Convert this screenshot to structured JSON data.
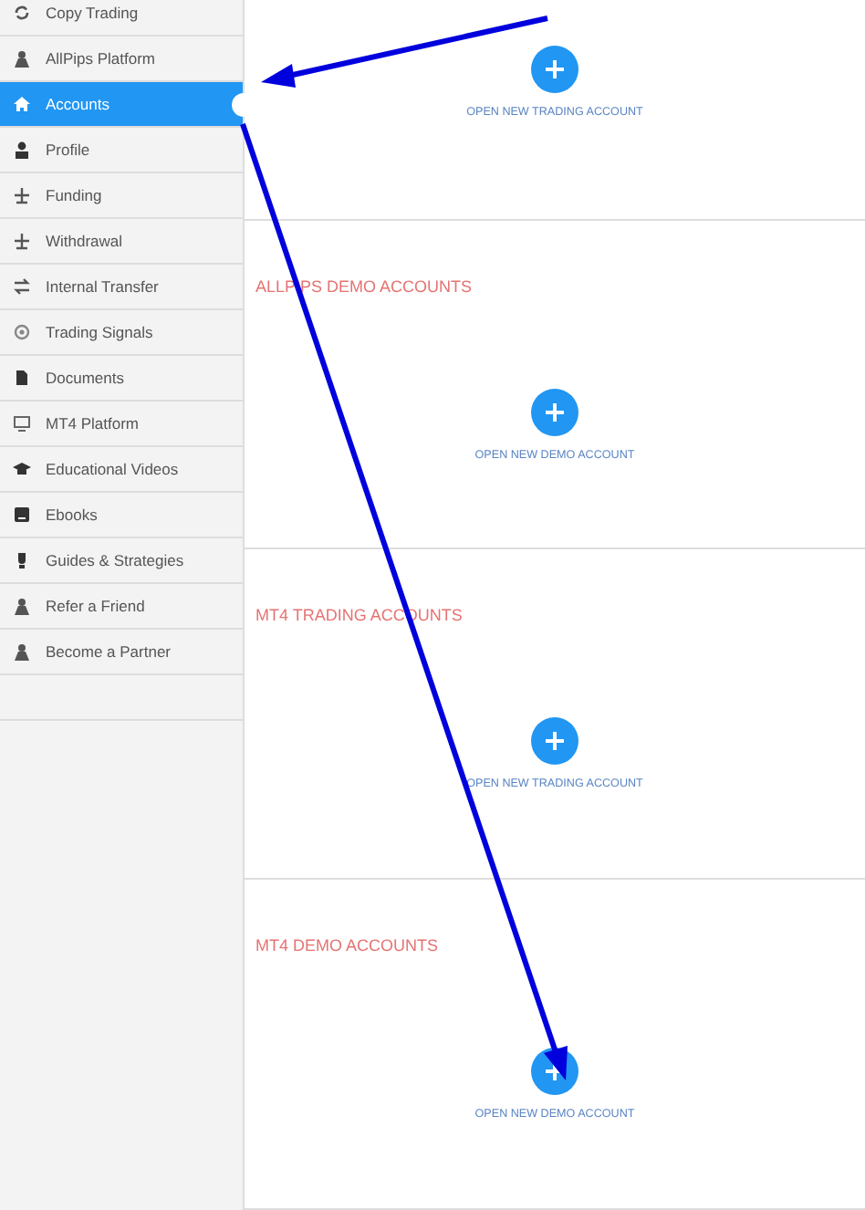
{
  "sidebar": {
    "items": [
      {
        "label": "Copy Trading",
        "selected": false
      },
      {
        "label": "AllPips Platform",
        "selected": false
      },
      {
        "label": "Accounts",
        "selected": true
      },
      {
        "label": "Profile",
        "selected": false
      },
      {
        "label": "Funding",
        "selected": false
      },
      {
        "label": "Withdrawal",
        "selected": false
      },
      {
        "label": "Internal Transfer",
        "selected": false
      },
      {
        "label": "Trading Signals",
        "selected": false
      },
      {
        "label": "Documents",
        "selected": false
      },
      {
        "label": "MT4 Platform",
        "selected": false
      },
      {
        "label": "Educational Videos",
        "selected": false
      },
      {
        "label": "Ebooks",
        "selected": false
      },
      {
        "label": "Guides & Strategies",
        "selected": false
      },
      {
        "label": "Refer a Friend",
        "selected": false
      },
      {
        "label": "Become a Partner",
        "selected": false
      }
    ]
  },
  "sections": [
    {
      "button_label": "OPEN NEW TRADING ACCOUNT"
    },
    {
      "title": "ALLPIPS DEMO ACCOUNTS",
      "button_label": "OPEN NEW DEMO ACCOUNT"
    },
    {
      "title": "MT4 TRADING ACCOUNTS",
      "button_label": "OPEN NEW TRADING ACCOUNT"
    },
    {
      "title": "MT4 DEMO ACCOUNTS",
      "button_label": "OPEN NEW DEMO ACCOUNT"
    }
  ]
}
